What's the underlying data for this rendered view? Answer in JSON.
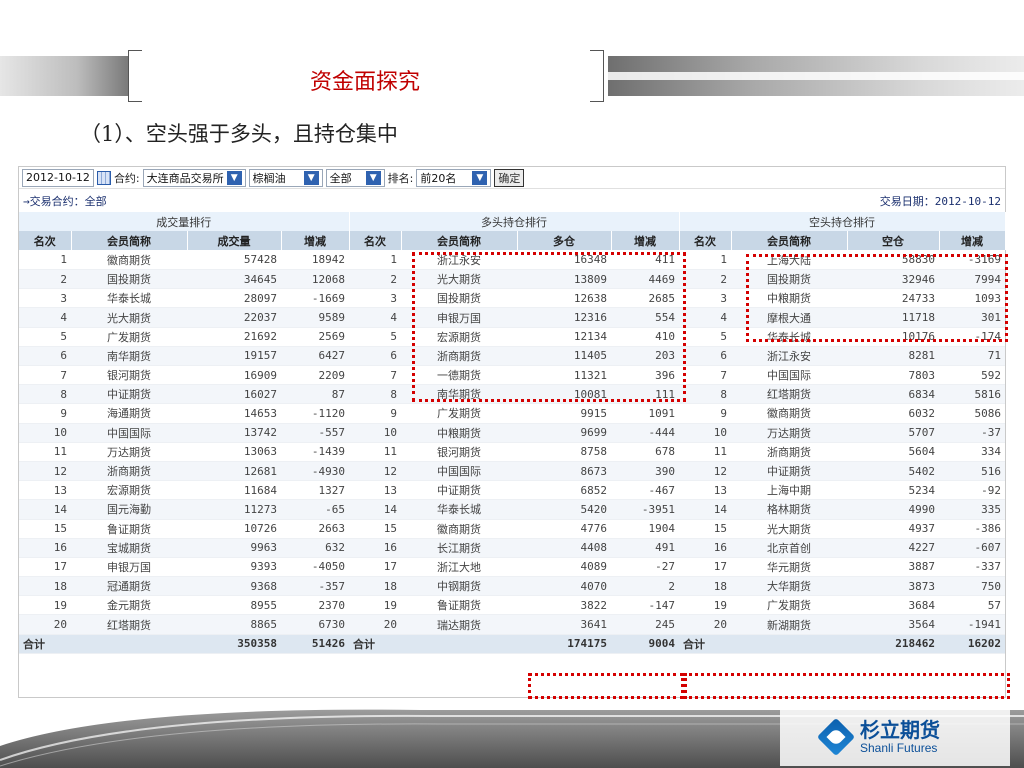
{
  "slide": {
    "title": "资金面探究",
    "subtitle": "（1）、空头强于多头，且持仓集中",
    "logo_cn": "杉立期货",
    "logo_en": "Shanli Futures"
  },
  "toolbar": {
    "date_value": "2012-10-12",
    "contract_label": "合约:",
    "exchange_value": "大连商品交易所",
    "product_value": "棕榈油",
    "month_value": "全部",
    "rank_label": "排名:",
    "rank_value": "前20名",
    "confirm_label": "确定"
  },
  "info": {
    "contract_text": "→交易合约：全部",
    "trade_date_text": "交易日期：2012-10-12"
  },
  "groups": {
    "volume": "成交量排行",
    "long": "多头持仓排行",
    "short": "空头持仓排行"
  },
  "headers": [
    "名次",
    "会员简称",
    "成交量",
    "增减",
    "名次",
    "会员简称",
    "多仓",
    "增减",
    "名次",
    "会员简称",
    "空仓",
    "增减"
  ],
  "rows": [
    [
      "1",
      "徽商期货",
      "57428",
      "18942",
      "1",
      "浙江永安",
      "16348",
      "411",
      "1",
      "上海大陆",
      "58830",
      "-3169"
    ],
    [
      "2",
      "国投期货",
      "34645",
      "12068",
      "2",
      "光大期货",
      "13809",
      "4469",
      "2",
      "国投期货",
      "32946",
      "7994"
    ],
    [
      "3",
      "华泰长城",
      "28097",
      "-1669",
      "3",
      "国投期货",
      "12638",
      "2685",
      "3",
      "中粮期货",
      "24733",
      "1093"
    ],
    [
      "4",
      "光大期货",
      "22037",
      "9589",
      "4",
      "申银万国",
      "12316",
      "554",
      "4",
      "摩根大通",
      "11718",
      "301"
    ],
    [
      "5",
      "广发期货",
      "21692",
      "2569",
      "5",
      "宏源期货",
      "12134",
      "410",
      "5",
      "华泰长城",
      "10176",
      "-174"
    ],
    [
      "6",
      "南华期货",
      "19157",
      "6427",
      "6",
      "浙商期货",
      "11405",
      "203",
      "6",
      "浙江永安",
      "8281",
      "71"
    ],
    [
      "7",
      "银河期货",
      "16909",
      "2209",
      "7",
      "一德期货",
      "11321",
      "396",
      "7",
      "中国国际",
      "7803",
      "592"
    ],
    [
      "8",
      "中证期货",
      "16027",
      "87",
      "8",
      "南华期货",
      "10081",
      "111",
      "8",
      "红塔期货",
      "6834",
      "5816"
    ],
    [
      "9",
      "海通期货",
      "14653",
      "-1120",
      "9",
      "广发期货",
      "9915",
      "1091",
      "9",
      "徽商期货",
      "6032",
      "5086"
    ],
    [
      "10",
      "中国国际",
      "13742",
      "-557",
      "10",
      "中粮期货",
      "9699",
      "-444",
      "10",
      "万达期货",
      "5707",
      "-37"
    ],
    [
      "11",
      "万达期货",
      "13063",
      "-1439",
      "11",
      "银河期货",
      "8758",
      "678",
      "11",
      "浙商期货",
      "5604",
      "334"
    ],
    [
      "12",
      "浙商期货",
      "12681",
      "-4930",
      "12",
      "中国国际",
      "8673",
      "390",
      "12",
      "中证期货",
      "5402",
      "516"
    ],
    [
      "13",
      "宏源期货",
      "11684",
      "1327",
      "13",
      "中证期货",
      "6852",
      "-467",
      "13",
      "上海中期",
      "5234",
      "-92"
    ],
    [
      "14",
      "国元海勤",
      "11273",
      "-65",
      "14",
      "华泰长城",
      "5420",
      "-3951",
      "14",
      "格林期货",
      "4990",
      "335"
    ],
    [
      "15",
      "鲁证期货",
      "10726",
      "2663",
      "15",
      "徽商期货",
      "4776",
      "1904",
      "15",
      "光大期货",
      "4937",
      "-386"
    ],
    [
      "16",
      "宝城期货",
      "9963",
      "632",
      "16",
      "长江期货",
      "4408",
      "491",
      "16",
      "北京首创",
      "4227",
      "-607"
    ],
    [
      "17",
      "申银万国",
      "9393",
      "-4050",
      "17",
      "浙江大地",
      "4089",
      "-27",
      "17",
      "华元期货",
      "3887",
      "-337"
    ],
    [
      "18",
      "冠通期货",
      "9368",
      "-357",
      "18",
      "中钢期货",
      "4070",
      "2",
      "18",
      "大华期货",
      "3873",
      "750"
    ],
    [
      "19",
      "金元期货",
      "8955",
      "2370",
      "19",
      "鲁证期货",
      "3822",
      "-147",
      "19",
      "广发期货",
      "3684",
      "57"
    ],
    [
      "20",
      "红塔期货",
      "8865",
      "6730",
      "20",
      "瑞达期货",
      "3641",
      "245",
      "20",
      "新湖期货",
      "3564",
      "-1941"
    ]
  ],
  "totals": {
    "label": "合计",
    "volume": "350358",
    "volume_change": "51426",
    "long_label": "合计",
    "long": "174175",
    "long_change": "9004",
    "short_label": "合计",
    "short": "218462",
    "short_change": "16202"
  }
}
